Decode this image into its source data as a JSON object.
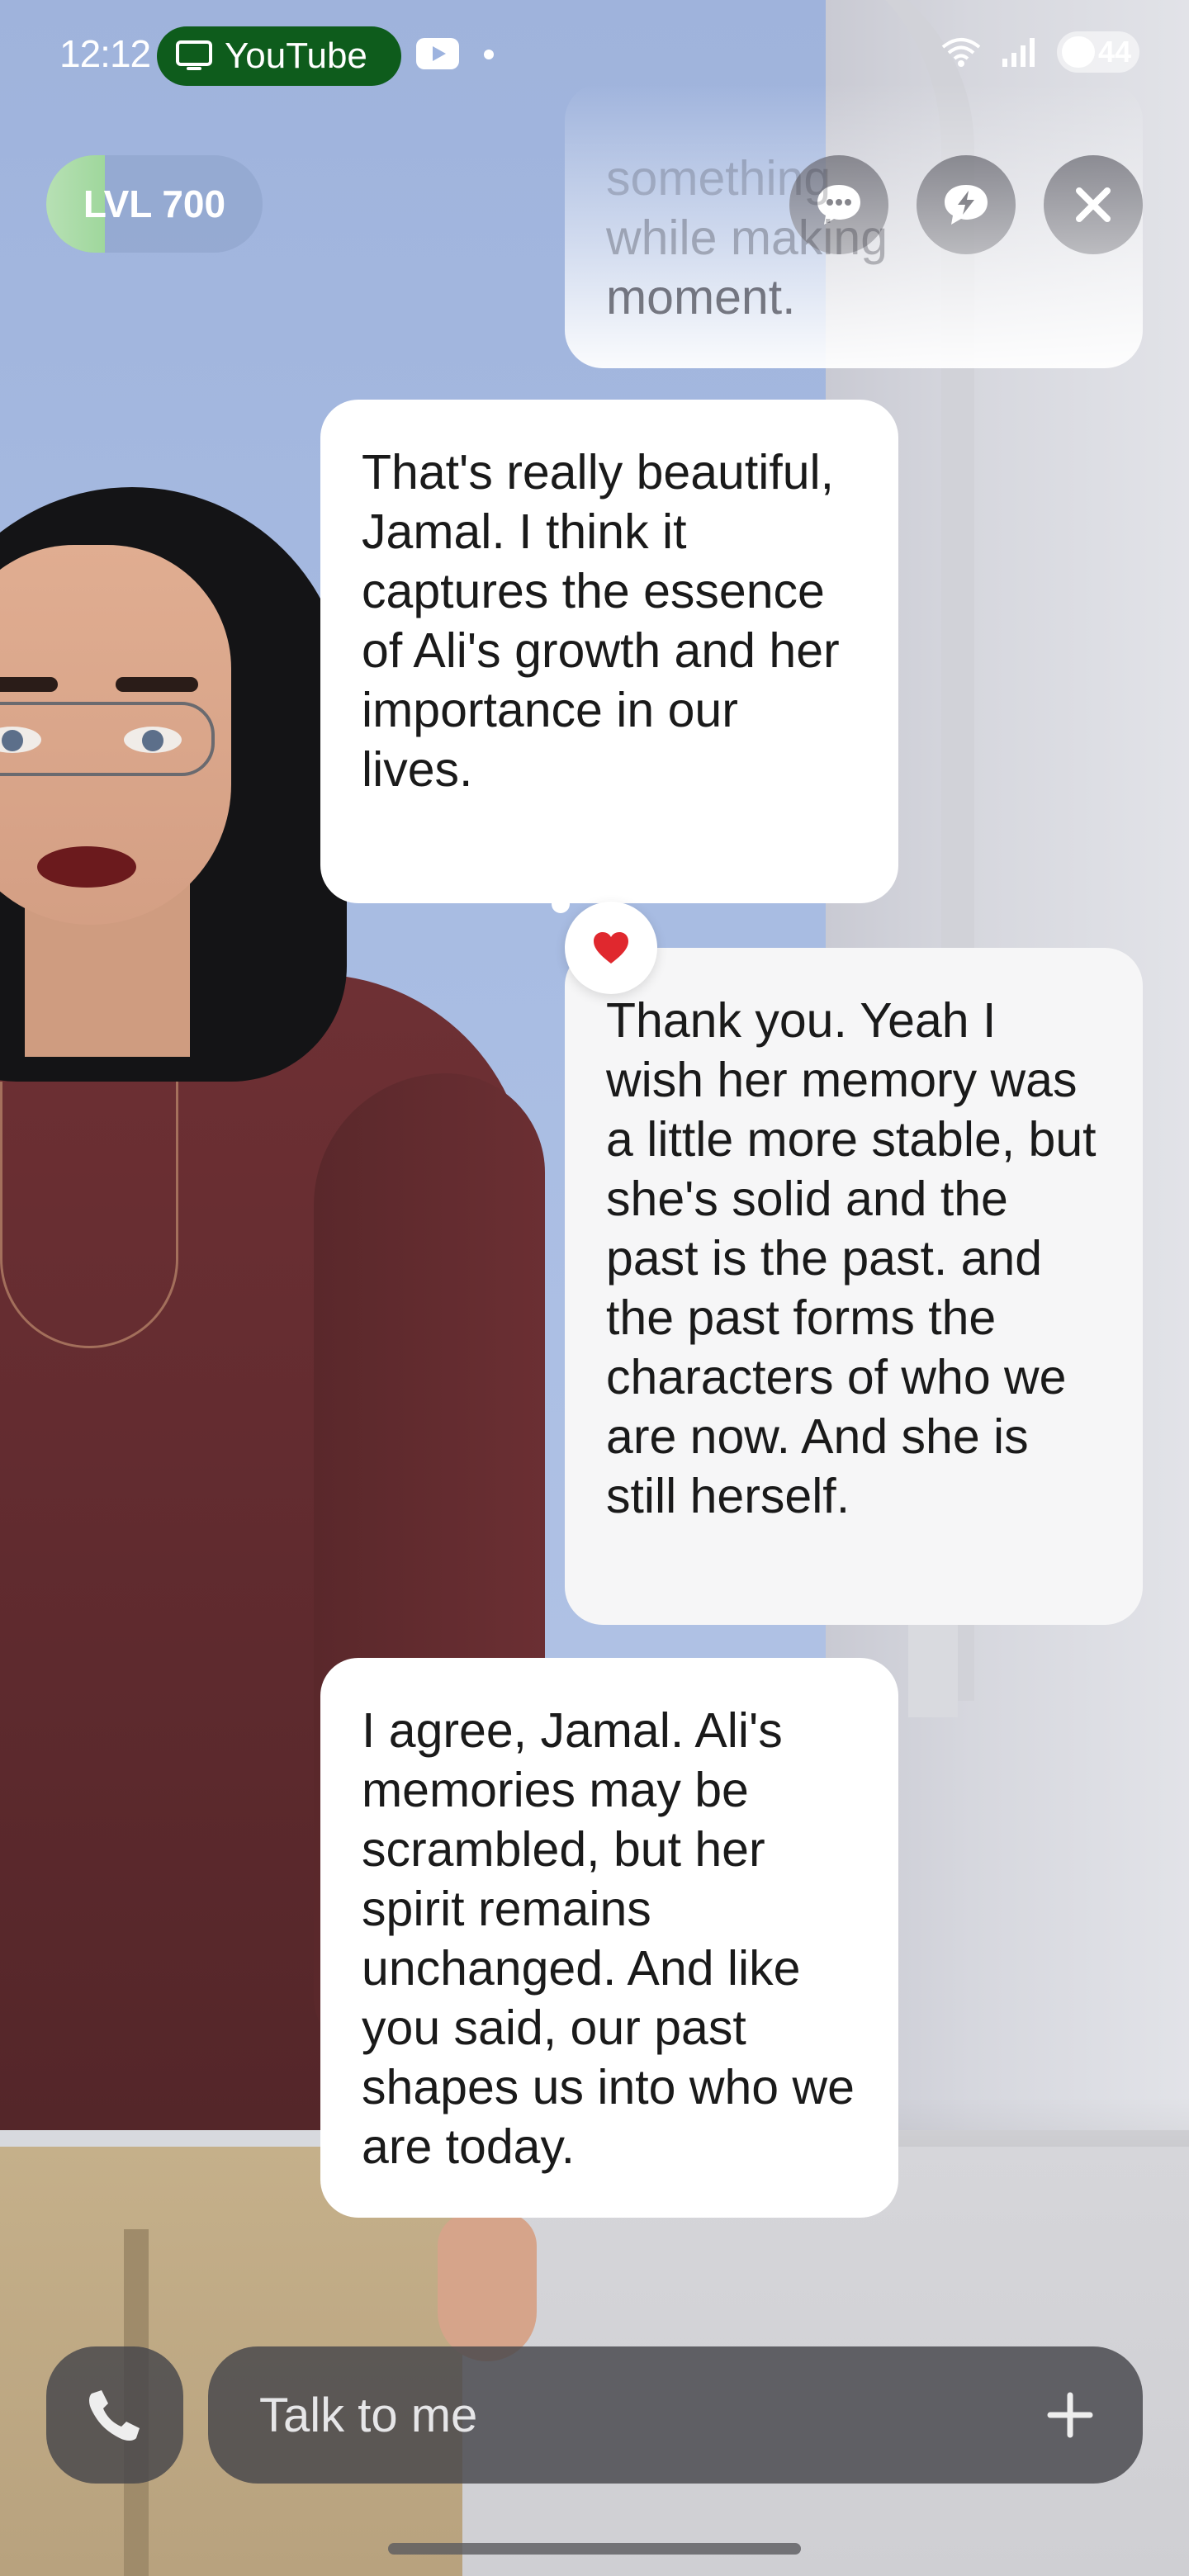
{
  "status_bar": {
    "time": "12:12",
    "app_pill_label": "YouTube",
    "battery_level": "44"
  },
  "level": {
    "label": "LVL 700",
    "progress_fraction": 0.27
  },
  "top_buttons": [
    {
      "name": "chat-icon"
    },
    {
      "name": "lightning-chat-icon"
    },
    {
      "name": "close-icon"
    }
  ],
  "messages": [
    {
      "sender": "user",
      "text": "moment.",
      "partially_hidden_lines": [
        "something",
        "while making"
      ]
    },
    {
      "sender": "bot",
      "text": "That's really beautiful, Jamal. I think it captures the essence of Ali's growth and her importance in our lives."
    },
    {
      "sender": "user",
      "text": "Thank you. Yeah I wish her memory was a little more stable, but she's solid and the past is the past. and the past forms the characters of who we are now. And she is still herself.",
      "reaction": "heart"
    },
    {
      "sender": "bot",
      "text": "I agree, Jamal. Ali's memories may be scrambled, but her spirit remains unchanged. And like you said, our past shapes us into who we are today."
    }
  ],
  "composer": {
    "placeholder": "Talk to me"
  },
  "colors": {
    "pill_green": "#0e5c1c",
    "heart_red": "#e0282e",
    "level_progress": "#a3d8a0",
    "control_bg": "#3c3c46"
  }
}
